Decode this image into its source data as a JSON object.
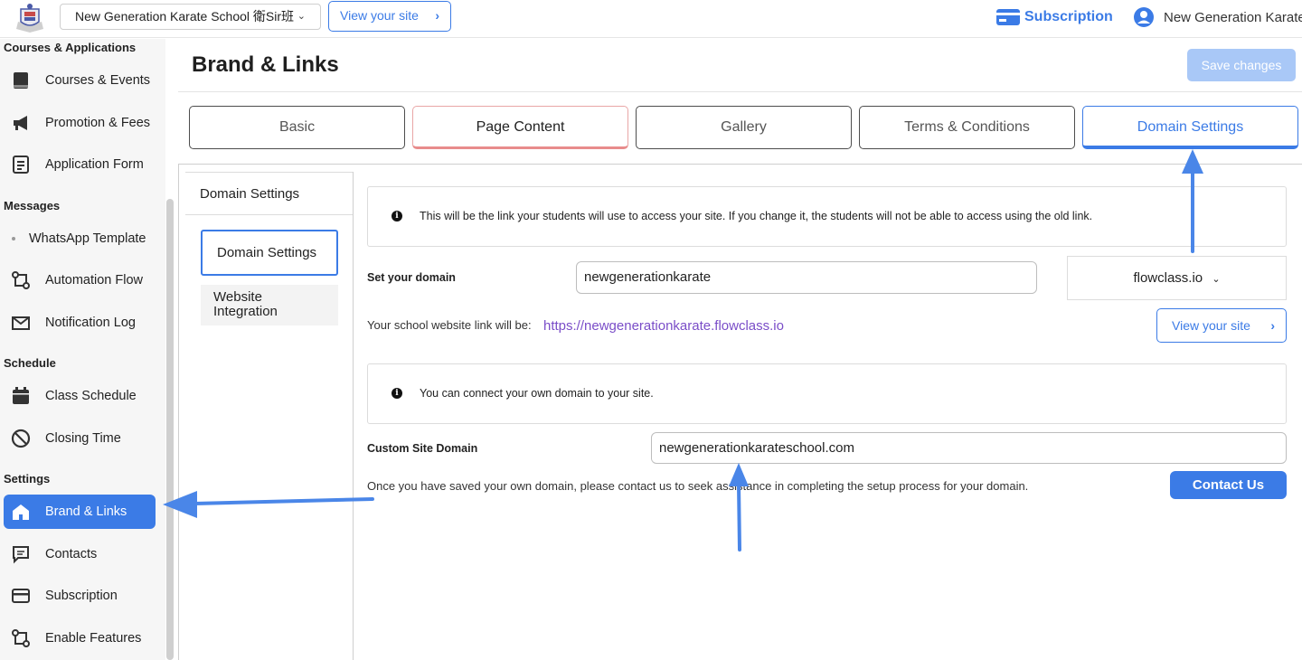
{
  "topbar": {
    "school_name": "New Generation Karate School 衛Sir班",
    "view_site_label": "View your site",
    "subscription_label": "Subscription",
    "user_name": "New Generation Karate"
  },
  "sidebar": {
    "sections": [
      {
        "title": "Courses & Applications"
      },
      {
        "title": "Messages"
      },
      {
        "title": "Schedule"
      },
      {
        "title": "Settings"
      }
    ],
    "items": [
      {
        "label": "Courses & Events",
        "icon": "book-icon"
      },
      {
        "label": "Promotion & Fees",
        "icon": "megaphone-icon"
      },
      {
        "label": "Application Form",
        "icon": "form-icon"
      },
      {
        "label": "WhatsApp Template",
        "icon": "dot-icon"
      },
      {
        "label": "Automation Flow",
        "icon": "flow-icon"
      },
      {
        "label": "Notification Log",
        "icon": "inbox-icon"
      },
      {
        "label": "Class Schedule",
        "icon": "calendar-icon"
      },
      {
        "label": "Closing Time",
        "icon": "ban-icon"
      },
      {
        "label": "Brand & Links",
        "icon": "home-icon",
        "active": true
      },
      {
        "label": "Contacts",
        "icon": "message-icon"
      },
      {
        "label": "Subscription",
        "icon": "card-icon"
      },
      {
        "label": "Enable Features",
        "icon": "flow-icon"
      }
    ]
  },
  "page": {
    "title": "Brand & Links",
    "save_label": "Save changes"
  },
  "tabs": [
    {
      "label": "Basic"
    },
    {
      "label": "Page Content"
    },
    {
      "label": "Gallery"
    },
    {
      "label": "Terms & Conditions"
    },
    {
      "label": "Domain Settings",
      "active": true
    }
  ],
  "subnav": {
    "header": "Domain Settings",
    "items": [
      {
        "label": "Domain Settings",
        "active": true
      },
      {
        "label": "Website Integration"
      }
    ]
  },
  "domain": {
    "info_text": "This will be the link your students will use to access your site. If you change it, the students will not be able to access using the old link.",
    "set_domain_label": "Set your domain",
    "domain_value": "newgenerationkarate",
    "domain_suffix": "flowclass.io",
    "link_prefix": "Your school website link will be:",
    "link_url": "https://newgenerationkarate.flowclass.io",
    "view_site_label": "View your site"
  },
  "custom_domain": {
    "info_text": "You can connect your own domain to your site.",
    "label": "Custom Site Domain",
    "value": "newgenerationkarateschool.com",
    "note": "Once you have saved your own domain, please contact us to seek assistance in completing the setup process for your domain.",
    "contact_label": "Contact Us"
  },
  "colors": {
    "accent": "#3b7be6",
    "link": "#7a4dc8",
    "save_disabled": "#a9c8f7"
  }
}
